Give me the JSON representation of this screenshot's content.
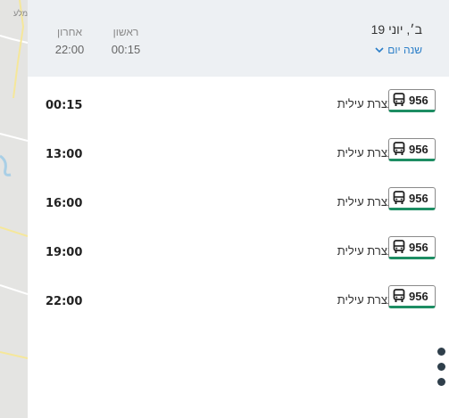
{
  "map": {
    "label": "מלע"
  },
  "header": {
    "date": "ב׳, יוני 19",
    "change_day_label": "שנה יום",
    "first_label": "ראשון",
    "first_time": "00:15",
    "last_label": "אחרון",
    "last_time": "22:00"
  },
  "trips": [
    {
      "time": "00:15",
      "route": "956",
      "destination": "נצרת עילית"
    },
    {
      "time": "13:00",
      "route": "956",
      "destination": "נצרת עילית"
    },
    {
      "time": "16:00",
      "route": "956",
      "destination": "נצרת עילית"
    },
    {
      "time": "19:00",
      "route": "956",
      "destination": "נצרת עילית"
    },
    {
      "time": "22:00",
      "route": "956",
      "destination": "נצרת עילית"
    }
  ],
  "colors": {
    "route_underline": "#1d8d63",
    "link": "#2a7ec8",
    "header_bg": "#edf0f3"
  },
  "icons": {
    "bus": "bus-icon",
    "chevron": "chevron-down-icon",
    "more": "more-vertical-icon"
  }
}
